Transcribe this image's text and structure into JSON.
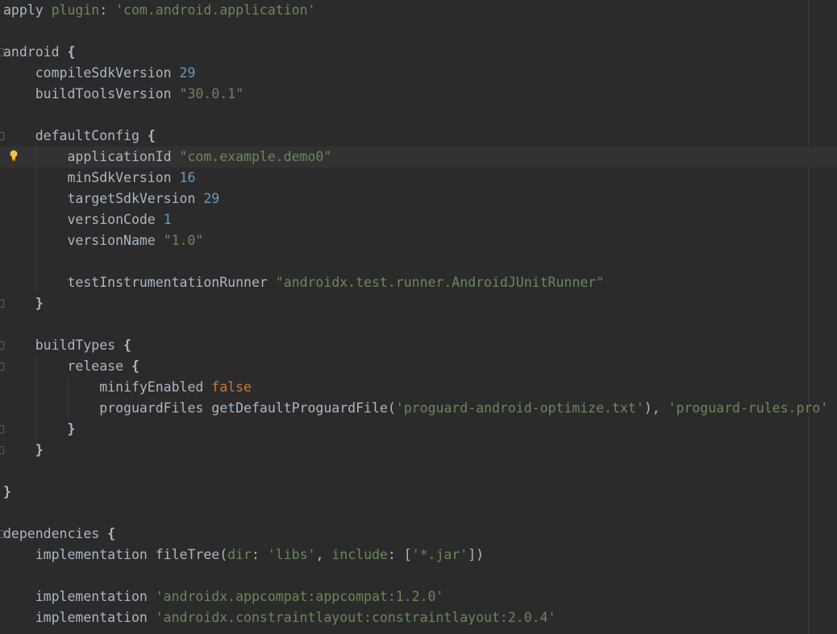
{
  "editor": {
    "background": "#2b2b2b",
    "current_line_background": "#323232",
    "colors": {
      "text": "#a9b7c6",
      "number": "#6897bb",
      "string": "#6a8759",
      "keyword": "#cc7832"
    },
    "intention_icon": "lightbulb-icon",
    "lines": [
      {
        "tokens": [
          [
            "plain",
            "apply "
          ],
          [
            "named",
            "plugin"
          ],
          [
            "plain",
            ": "
          ],
          [
            "str",
            "'com.android.application'"
          ]
        ]
      },
      {
        "tokens": []
      },
      {
        "tokens": [
          [
            "plain",
            "android "
          ],
          [
            "brace",
            "{"
          ]
        ]
      },
      {
        "tokens": [
          [
            "plain",
            "    compileSdkVersion "
          ],
          [
            "num",
            "29"
          ]
        ]
      },
      {
        "tokens": [
          [
            "plain",
            "    buildToolsVersion "
          ],
          [
            "str",
            "\"30.0.1\""
          ]
        ]
      },
      {
        "tokens": []
      },
      {
        "tokens": [
          [
            "plain",
            "    defaultConfig "
          ],
          [
            "brace",
            "{"
          ]
        ]
      },
      {
        "tokens": [
          [
            "plain",
            "        applicationId "
          ],
          [
            "str",
            "\"com.example.demo0\""
          ]
        ],
        "current": true
      },
      {
        "tokens": [
          [
            "plain",
            "        minSdkVersion "
          ],
          [
            "num",
            "16"
          ]
        ]
      },
      {
        "tokens": [
          [
            "plain",
            "        targetSdkVersion "
          ],
          [
            "num",
            "29"
          ]
        ]
      },
      {
        "tokens": [
          [
            "plain",
            "        versionCode "
          ],
          [
            "num",
            "1"
          ]
        ]
      },
      {
        "tokens": [
          [
            "plain",
            "        versionName "
          ],
          [
            "str",
            "\"1.0\""
          ]
        ]
      },
      {
        "tokens": []
      },
      {
        "tokens": [
          [
            "plain",
            "        testInstrumentationRunner "
          ],
          [
            "str",
            "\"androidx.test.runner.AndroidJUnitRunner\""
          ]
        ]
      },
      {
        "tokens": [
          [
            "plain",
            "    "
          ],
          [
            "brace",
            "}"
          ]
        ]
      },
      {
        "tokens": []
      },
      {
        "tokens": [
          [
            "plain",
            "    buildTypes "
          ],
          [
            "brace",
            "{"
          ]
        ]
      },
      {
        "tokens": [
          [
            "plain",
            "        release "
          ],
          [
            "brace",
            "{"
          ]
        ]
      },
      {
        "tokens": [
          [
            "plain",
            "            minifyEnabled "
          ],
          [
            "bool",
            "false"
          ]
        ]
      },
      {
        "tokens": [
          [
            "plain",
            "            proguardFiles getDefaultProguardFile("
          ],
          [
            "str",
            "'proguard-android-optimize.txt'"
          ],
          [
            "plain",
            "), "
          ],
          [
            "str",
            "'proguard-rules.pro'"
          ]
        ]
      },
      {
        "tokens": [
          [
            "plain",
            "        "
          ],
          [
            "brace",
            "}"
          ]
        ]
      },
      {
        "tokens": [
          [
            "plain",
            "    "
          ],
          [
            "brace",
            "}"
          ]
        ]
      },
      {
        "tokens": []
      },
      {
        "tokens": [
          [
            "brace",
            "}"
          ]
        ]
      },
      {
        "tokens": []
      },
      {
        "tokens": [
          [
            "plain",
            "dependencies "
          ],
          [
            "brace",
            "{"
          ]
        ]
      },
      {
        "tokens": [
          [
            "plain",
            "    implementation fileTree("
          ],
          [
            "named",
            "dir"
          ],
          [
            "plain",
            ": "
          ],
          [
            "str",
            "'libs'"
          ],
          [
            "plain",
            ", "
          ],
          [
            "named",
            "include"
          ],
          [
            "plain",
            ": ["
          ],
          [
            "str",
            "'*.jar'"
          ],
          [
            "plain",
            "])"
          ]
        ]
      },
      {
        "tokens": []
      },
      {
        "tokens": [
          [
            "plain",
            "    implementation "
          ],
          [
            "str",
            "'androidx.appcompat:appcompat:1.2.0'"
          ]
        ]
      },
      {
        "tokens": [
          [
            "plain",
            "    implementation "
          ],
          [
            "str",
            "'androidx.constraintlayout:constraintlayout:2.0.4'"
          ]
        ]
      }
    ]
  }
}
